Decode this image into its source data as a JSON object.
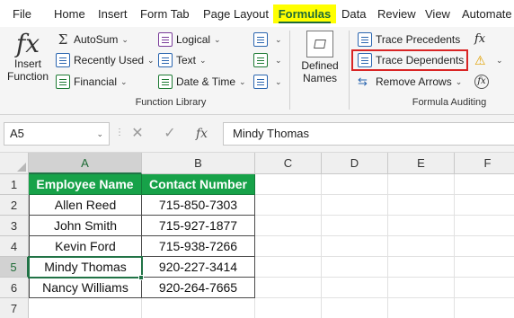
{
  "menu": {
    "tabs": [
      {
        "label": "File"
      },
      {
        "label": "Home"
      },
      {
        "label": "Insert"
      },
      {
        "label": "Form Tab"
      },
      {
        "label": "Page Layout"
      },
      {
        "label": "Formulas"
      },
      {
        "label": "Data"
      },
      {
        "label": "Review"
      },
      {
        "label": "View"
      },
      {
        "label": "Automate"
      }
    ],
    "active_tab": "Formulas"
  },
  "ribbon": {
    "insert_function": {
      "line1": "Insert",
      "line2": "Function",
      "icon": "fx-icon"
    },
    "function_library": {
      "label": "Function Library",
      "col1": [
        {
          "label": "AutoSum",
          "icon": "sigma-icon"
        },
        {
          "label": "Recently Used",
          "icon": "star-icon"
        },
        {
          "label": "Financial",
          "icon": "financial-icon"
        }
      ],
      "col2": [
        {
          "label": "Logical",
          "icon": "logical-icon"
        },
        {
          "label": "Text",
          "icon": "text-icon"
        },
        {
          "label": "Date & Time",
          "icon": "date-time-icon"
        }
      ]
    },
    "defined_names": {
      "line1": "Defined",
      "line2": "Names"
    },
    "formula_auditing": {
      "label": "Formula Auditing",
      "trace_precedents": "Trace Precedents",
      "trace_dependents": "Trace Dependents",
      "remove_arrows": "Remove Arrows"
    },
    "highlight_color": "#d92525"
  },
  "formula_bar": {
    "name_box": "A5",
    "fx": "fx",
    "content": "Mindy Thomas"
  },
  "grid": {
    "columns": [
      "A",
      "B",
      "C",
      "D",
      "E",
      "F"
    ],
    "rows": [
      "1",
      "2",
      "3",
      "4",
      "5",
      "6",
      "7"
    ],
    "header_color": "#17a249",
    "table": {
      "headers": [
        "Employee Name",
        "Contact Number"
      ],
      "rows": [
        [
          "Allen Reed",
          "715-850-7303"
        ],
        [
          "John Smith",
          "715-927-1877"
        ],
        [
          "Kevin Ford",
          "715-938-7266"
        ],
        [
          "Mindy Thomas",
          "920-227-3414"
        ],
        [
          "Nancy Williams",
          "920-264-7665"
        ]
      ]
    },
    "active_cell": "A5"
  }
}
